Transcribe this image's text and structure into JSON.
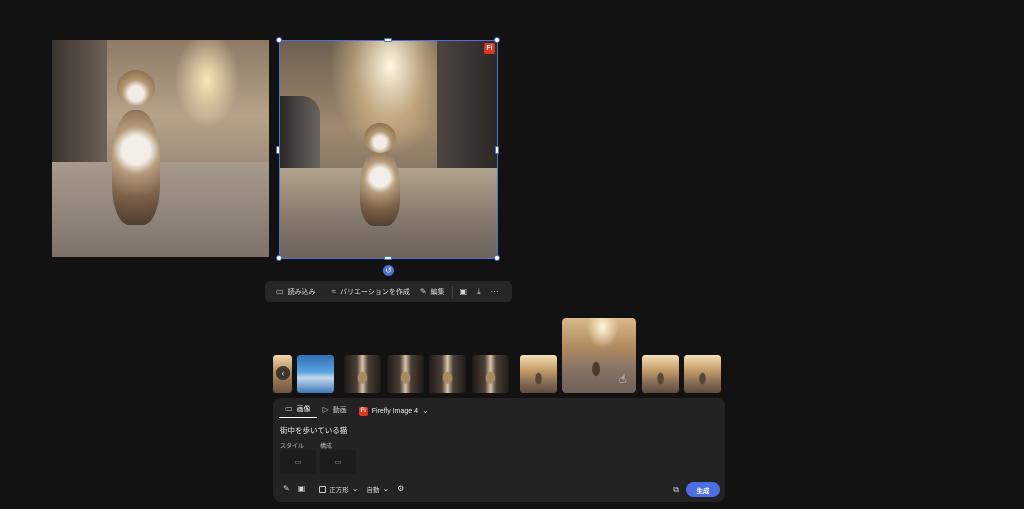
{
  "canvas": {
    "image1_alt": "",
    "image2_badge": "Fi",
    "rotate_glyph": "↺"
  },
  "context_toolbar": {
    "import_label": "読み込み",
    "variations_label": "バリエーションを作成",
    "edit_label": "編集"
  },
  "thumbnails": {
    "prev_arrow": "‹"
  },
  "panel": {
    "tab_image": "画像",
    "tab_video": "動画",
    "model_badge": "Fi",
    "model_name": "Firefly Image 4",
    "prompt_text": "街中を歩いている猫",
    "style_label": "スタイル",
    "composition_label": "構成",
    "aspect_label": "正方形",
    "auto_label": "自動",
    "generate_label": "生成"
  },
  "colors": {
    "background": "#121213",
    "accent": "#4b6ee3",
    "firefly_red": "#e0341c",
    "panel": "#232323"
  }
}
